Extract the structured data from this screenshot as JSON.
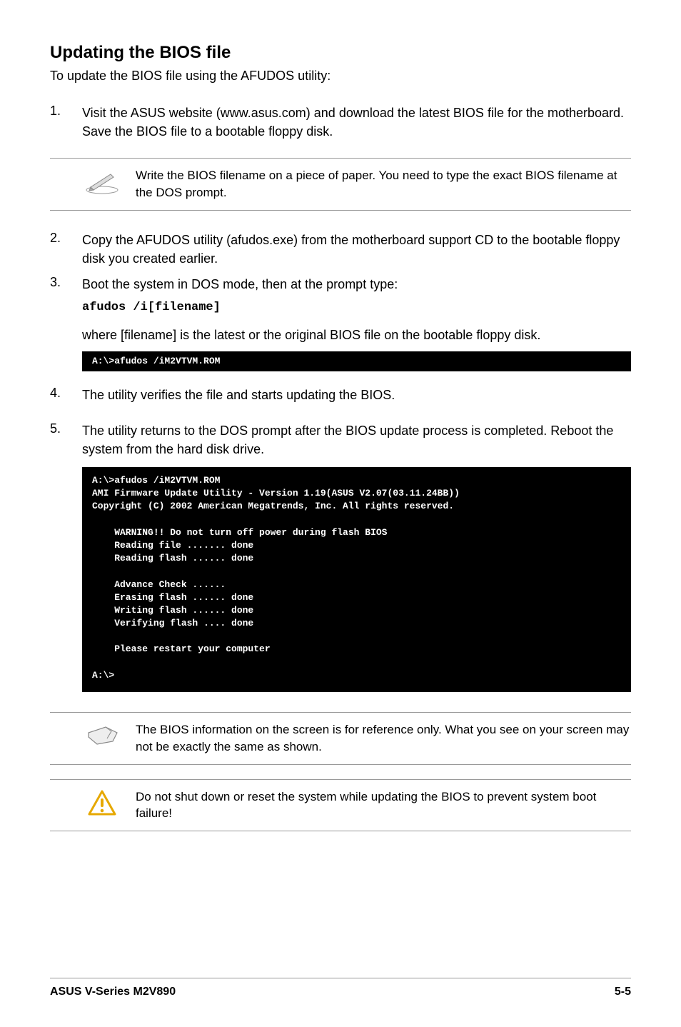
{
  "heading": "Updating the BIOS file",
  "intro": "To update the BIOS file using the AFUDOS utility:",
  "steps": {
    "s1": {
      "num": "1.",
      "text": "Visit the ASUS website (www.asus.com) and download the latest BIOS file for the motherboard. Save the BIOS file to a bootable floppy disk."
    },
    "s2": {
      "num": "2.",
      "text": "Copy the AFUDOS utility (afudos.exe) from the motherboard support CD to the bootable floppy disk you created earlier."
    },
    "s3": {
      "num": "3.",
      "text": "Boot the system in DOS mode, then at the prompt type:"
    },
    "s4": {
      "num": "4.",
      "text": "The utility verifies the file and starts updating the BIOS."
    },
    "s5": {
      "num": "5.",
      "text": "The utility returns to the DOS prompt after the BIOS update process is completed. Reboot the system from the hard disk drive."
    }
  },
  "note1": "Write the BIOS filename on a piece of paper. You need to type the exact BIOS filename at the DOS prompt.",
  "code1": "afudos /i[filename]",
  "code1_desc": "where [filename] is the latest or the original BIOS file on the bootable floppy disk.",
  "terminal_small": "A:\\>afudos /iM2VTVM.ROM",
  "terminal_big": "A:\\>afudos /iM2VTVM.ROM\nAMI Firmware Update Utility - Version 1.19(ASUS V2.07(03.11.24BB))\nCopyright (C) 2002 American Megatrends, Inc. All rights reserved.\n\n    WARNING!! Do not turn off power during flash BIOS\n    Reading file ....... done\n    Reading flash ...... done\n\n    Advance Check ......\n    Erasing flash ...... done\n    Writing flash ...... done\n    Verifying flash .... done\n\n    Please restart your computer\n\nA:\\>",
  "note2": "The BIOS information on the screen is for reference only. What you see on your screen may not be exactly the same as shown.",
  "note3": "Do not shut down or reset the system while updating the BIOS to prevent system boot failure!",
  "footer_left": "ASUS V-Series M2V890",
  "footer_right": "5-5"
}
